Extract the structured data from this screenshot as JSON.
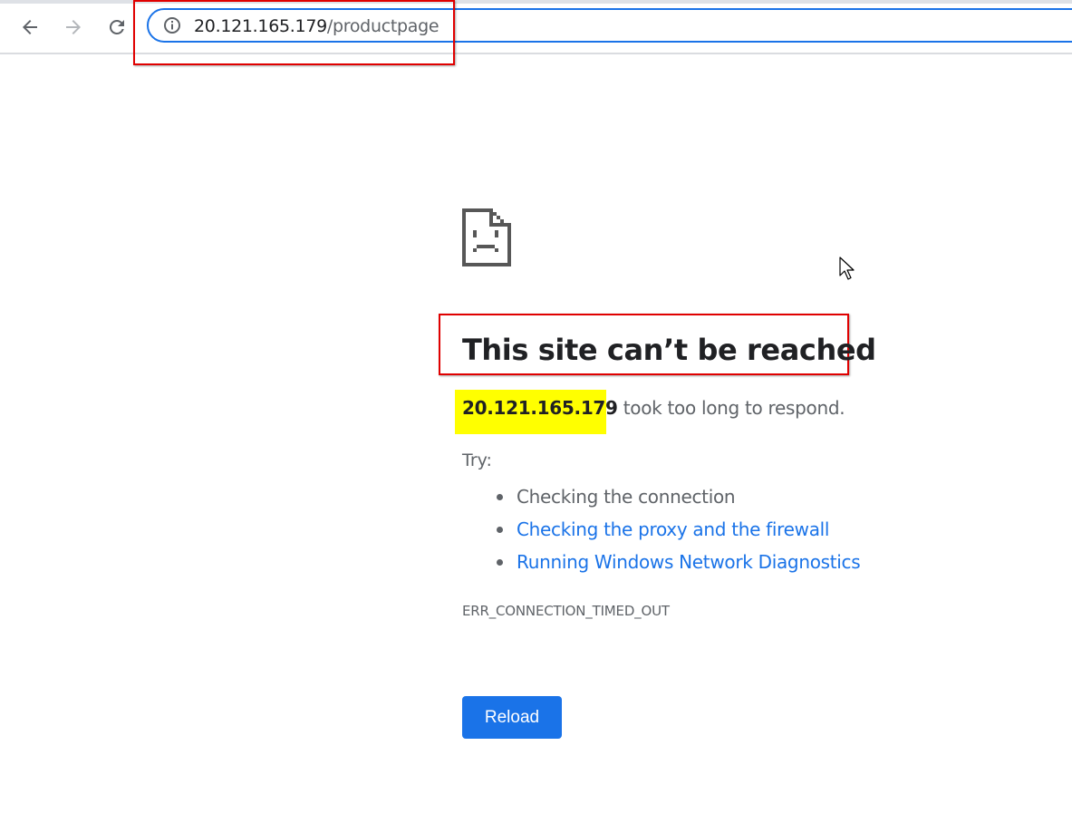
{
  "browser": {
    "back_icon": "arrow-left-icon",
    "forward_icon": "arrow-right-icon",
    "reload_icon": "reload-icon",
    "site_info_icon": "info-circle-icon",
    "url_host": "20.121.165.179",
    "url_path": "/productpage",
    "accent_color": "#1a73e8"
  },
  "error_page": {
    "icon": "sad-page-icon",
    "headline": "This site can’t be reached",
    "host": "20.121.165.179",
    "summary_suffix": " took too long to respond.",
    "try_label": "Try:",
    "suggestions": [
      {
        "label": "Checking the connection",
        "link": false
      },
      {
        "label": "Checking the proxy and the firewall",
        "link": true
      },
      {
        "label": "Running Windows Network Diagnostics",
        "link": true
      }
    ],
    "error_code": "ERR_CONNECTION_TIMED_OUT",
    "reload_label": "Reload"
  },
  "annotations": {
    "outline_color": "#e00000",
    "highlight_color": "#ffff00"
  }
}
